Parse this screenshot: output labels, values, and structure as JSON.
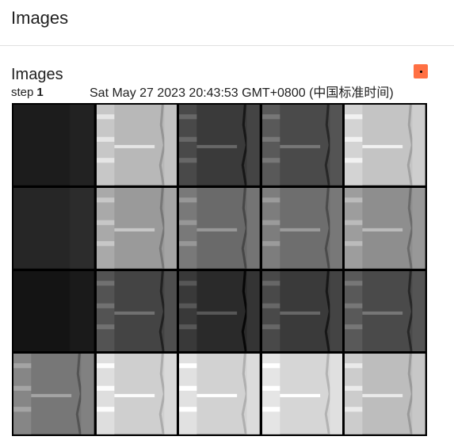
{
  "header": {
    "title": "Images"
  },
  "card": {
    "title": "Images",
    "step_label": "step",
    "step_value": "1",
    "timestamp": "Sat May 27 2023 20:43:53 GMT+0800 (中国标准时间)",
    "pin_icon": "pin-icon"
  },
  "grid": {
    "rows": 4,
    "cols": 5,
    "tones": [
      [
        "#1c1c1c",
        "#b8b8b8",
        "#3a3a3a",
        "#4a4a4a",
        "#c4c4c4"
      ],
      [
        "#262626",
        "#9a9a9a",
        "#6a6a6a",
        "#6e6e6e",
        "#8e8e8e"
      ],
      [
        "#141414",
        "#444444",
        "#2a2a2a",
        "#3a3a3a",
        "#4a4a4a"
      ],
      [
        "#777777",
        "#cfcfcf",
        "#d2d2d2",
        "#d6d6d6",
        "#bdbdbd"
      ]
    ]
  }
}
